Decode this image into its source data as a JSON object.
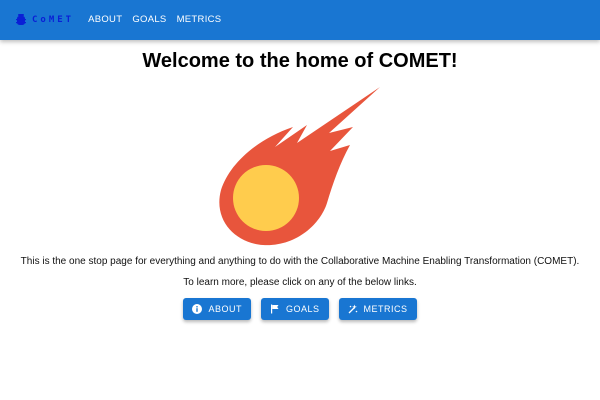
{
  "header": {
    "brand": "CoMET",
    "brand_icon": "bug-robot-icon",
    "nav": [
      {
        "label": "ABOUT"
      },
      {
        "label": "GOALS"
      },
      {
        "label": "METRICS"
      }
    ]
  },
  "main": {
    "title": "Welcome to the home of COMET!",
    "logo_icon": "comet-icon",
    "description": "This is the one stop page for everything and anything to do with the Collaborative Machine Enabling Transformation (COMET).",
    "subtext": "To learn more, please click on any of the below links.",
    "buttons": [
      {
        "label": "ABOUT",
        "icon": "info-icon"
      },
      {
        "label": "GOALS",
        "icon": "flag-icon"
      },
      {
        "label": "METRICS",
        "icon": "sparkles-icon"
      }
    ]
  },
  "colors": {
    "primary": "#1976d2",
    "comet_tail": "#e8553c",
    "comet_core": "#ffcc4d",
    "brand_text": "#0a1fd6"
  }
}
